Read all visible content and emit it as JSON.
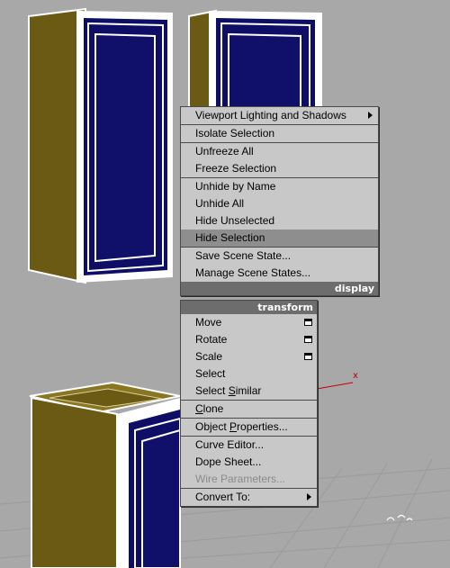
{
  "display_quad": {
    "title": "display",
    "items": [
      {
        "label": "Viewport Lighting and Shadows",
        "submenu": true
      },
      {
        "label": "Isolate Selection"
      },
      {
        "label": "Unfreeze All"
      },
      {
        "label": "Freeze Selection"
      },
      {
        "label": "Unhide by Name"
      },
      {
        "label": "Unhide All"
      },
      {
        "label": "Hide Unselected"
      },
      {
        "label": "Hide Selection",
        "highlighted": true
      },
      {
        "label": "Save Scene State..."
      },
      {
        "label": "Manage Scene States..."
      }
    ]
  },
  "transform_quad": {
    "title": "transform",
    "items": [
      {
        "label": "Move",
        "settings": true
      },
      {
        "label": "Rotate",
        "settings": true
      },
      {
        "label": "Scale",
        "settings": true
      },
      {
        "label": "Select"
      },
      {
        "label": "Select Similar",
        "underline": "S"
      },
      {
        "label": "Clone",
        "underline": "C"
      },
      {
        "label": "Object Properties...",
        "underline": "P"
      },
      {
        "label": "Curve Editor..."
      },
      {
        "label": "Dope Sheet..."
      },
      {
        "label": "Wire Parameters...",
        "disabled": true
      },
      {
        "label": "Convert To:",
        "submenu": true
      }
    ]
  },
  "viewport": {
    "axis_label": "x"
  },
  "colors": {
    "viewport_bg": "#a8a8a8",
    "cabinet_side": "#6b5a14",
    "cabinet_panel": "#10106a",
    "menu_bg": "#c8c8c8",
    "highlight": "#8e8e8e",
    "quad_title_bg": "#6d6d6d"
  }
}
